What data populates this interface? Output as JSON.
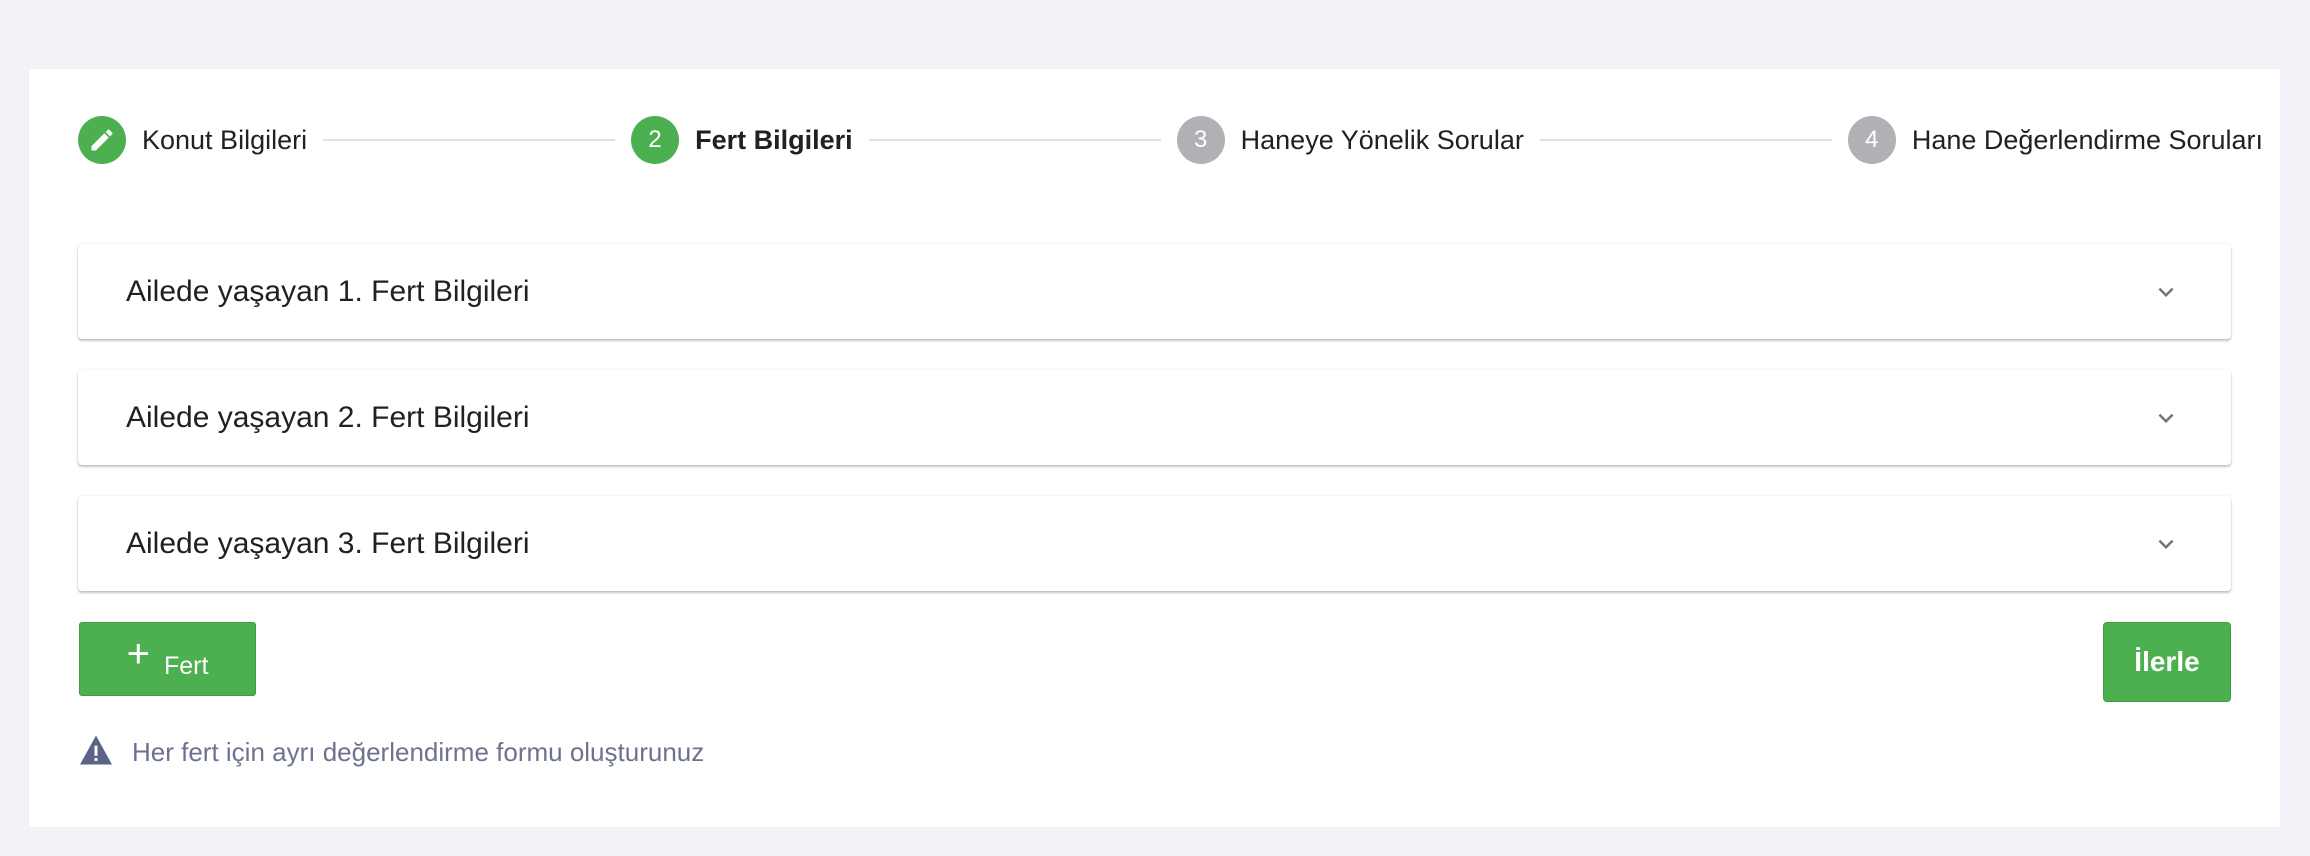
{
  "stepper": {
    "steps": [
      {
        "number": "",
        "label": "Konut Bilgileri",
        "state": "done"
      },
      {
        "number": "2",
        "label": "Fert Bilgileri",
        "state": "active"
      },
      {
        "number": "3",
        "label": "Haneye Yönelik Sorular",
        "state": "pending"
      },
      {
        "number": "4",
        "label": "Hane Değerlendirme Soruları",
        "state": "pending"
      }
    ]
  },
  "panels": [
    {
      "title": "Ailede yaşayan 1. Fert Bilgileri"
    },
    {
      "title": "Ailede yaşayan 2. Fert Bilgileri"
    },
    {
      "title": "Ailede yaşayan 3. Fert Bilgileri"
    }
  ],
  "actions": {
    "add_icon": "+",
    "add_label": "Fert",
    "next_label": "İlerle"
  },
  "note": {
    "text": "Her fert için ayrı değerlendirme formu oluşturunuz"
  },
  "colors": {
    "accent": "#4caf50",
    "pending": "#b0b1b5",
    "note": "#6d7290",
    "background": "#f1f2f7"
  }
}
